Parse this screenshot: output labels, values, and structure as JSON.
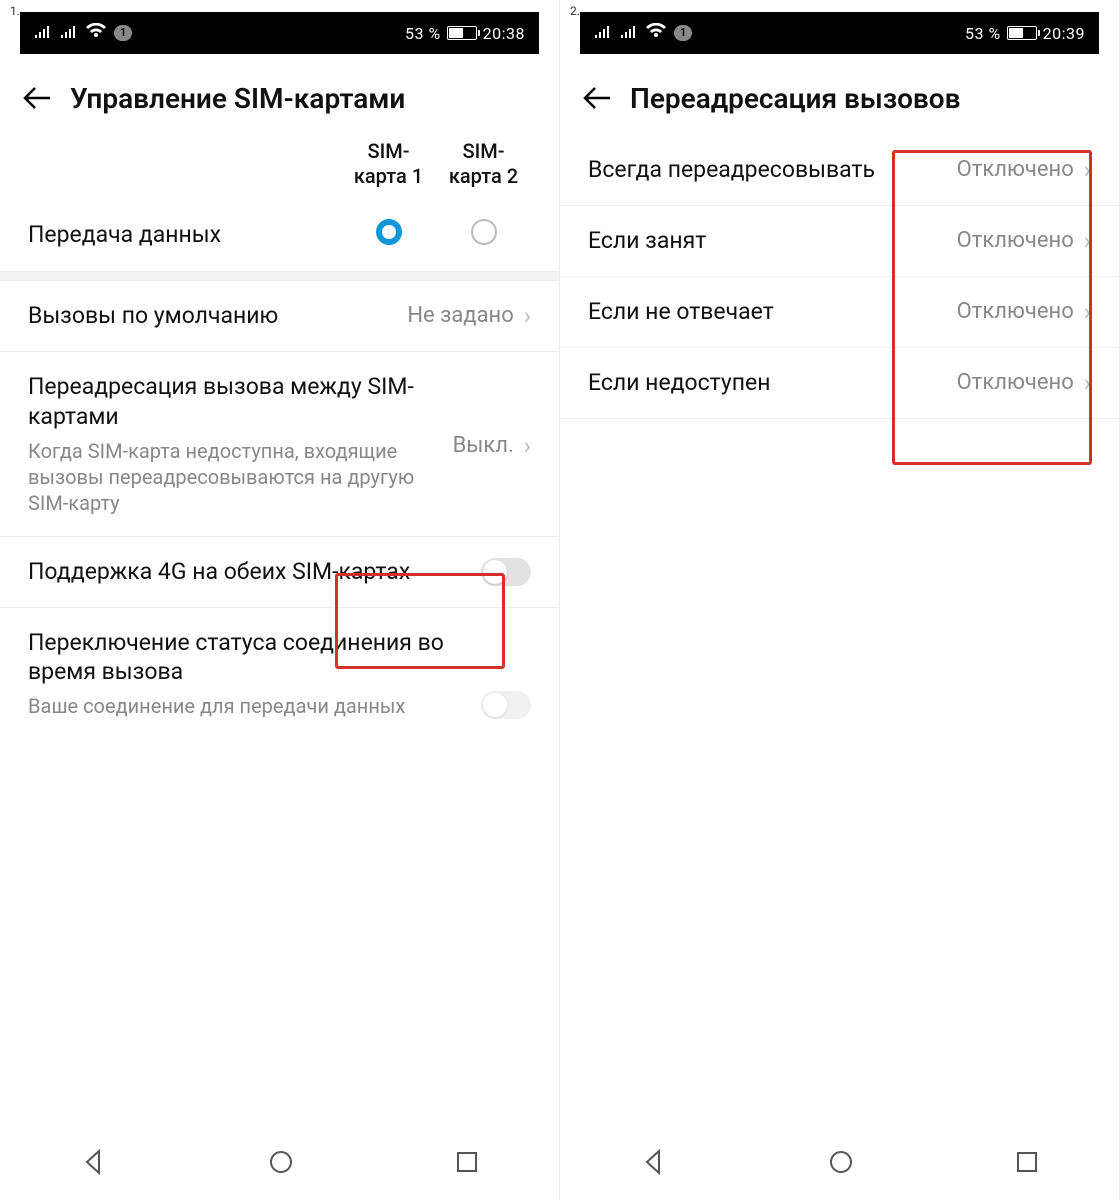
{
  "left": {
    "shot_num": "1.",
    "status": {
      "battery_pct": "53 %",
      "time": "20:38",
      "sim_badge": "1",
      "battery_fill_pct": 53
    },
    "title": "Управление SIM-картами",
    "sim_cols": {
      "c1": "SIM-карта 1",
      "c2": "SIM-карта 2"
    },
    "rows": {
      "data": {
        "label": "Передача данных",
        "selected": 1
      },
      "default_calls": {
        "label": "Вызовы по умолчанию",
        "value": "Не задано"
      },
      "forward": {
        "label": "Переадресация вызова между SIM-картами",
        "sub": "Когда SIM-карта недоступна, входящие вызовы переадресовываются на другую SIM-карту",
        "value": "Выкл."
      },
      "lte_both": {
        "label": "Поддержка 4G на обеих SIM-картах"
      },
      "switch_conn": {
        "label": "Переключение статуса соединения во время вызова",
        "sub": "Ваше соединение для передачи данных"
      }
    }
  },
  "right": {
    "shot_num": "2.",
    "status": {
      "battery_pct": "53 %",
      "time": "20:39",
      "sim_badge": "1",
      "battery_fill_pct": 53
    },
    "title": "Переадресация вызовов",
    "rows": [
      {
        "label": "Всегда переадресовывать",
        "value": "Отключено"
      },
      {
        "label": "Если занят",
        "value": "Отключено"
      },
      {
        "label": "Если не отвечает",
        "value": "Отключено"
      },
      {
        "label": "Если недоступен",
        "value": "Отключено"
      }
    ]
  }
}
